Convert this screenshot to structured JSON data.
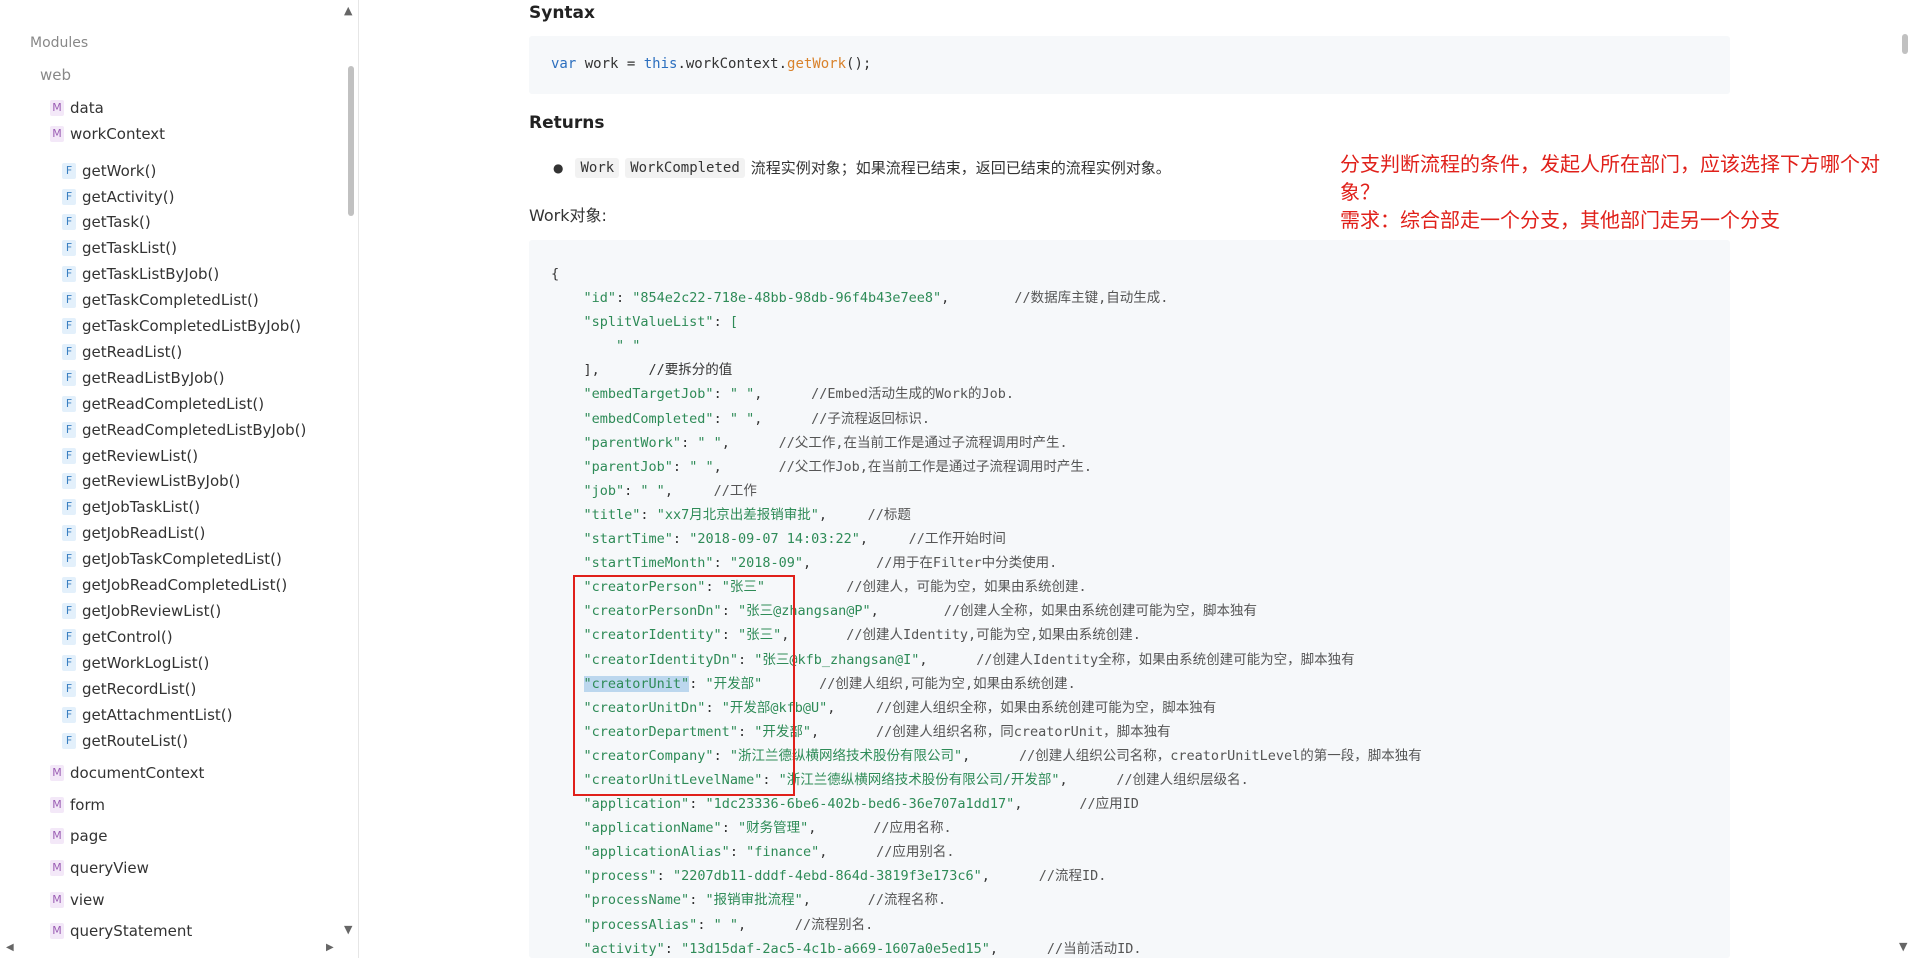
{
  "sidebar": {
    "modules_label": "Modules",
    "web_label": "web",
    "items": [
      {
        "type": "M",
        "label": "data"
      },
      {
        "type": "M",
        "label": "workContext"
      },
      {
        "type": "F",
        "label": "getWork()"
      },
      {
        "type": "F",
        "label": "getActivity()"
      },
      {
        "type": "F",
        "label": "getTask()"
      },
      {
        "type": "F",
        "label": "getTaskList()"
      },
      {
        "type": "F",
        "label": "getTaskListByJob()"
      },
      {
        "type": "F",
        "label": "getTaskCompletedList()"
      },
      {
        "type": "F",
        "label": "getTaskCompletedListByJob()"
      },
      {
        "type": "F",
        "label": "getReadList()"
      },
      {
        "type": "F",
        "label": "getReadListByJob()"
      },
      {
        "type": "F",
        "label": "getReadCompletedList()"
      },
      {
        "type": "F",
        "label": "getReadCompletedListByJob()"
      },
      {
        "type": "F",
        "label": "getReviewList()"
      },
      {
        "type": "F",
        "label": "getReviewListByJob()"
      },
      {
        "type": "F",
        "label": "getJobTaskList()"
      },
      {
        "type": "F",
        "label": "getJobReadList()"
      },
      {
        "type": "F",
        "label": "getJobTaskCompletedList()"
      },
      {
        "type": "F",
        "label": "getJobReadCompletedList()"
      },
      {
        "type": "F",
        "label": "getJobReviewList()"
      },
      {
        "type": "F",
        "label": "getControl()"
      },
      {
        "type": "F",
        "label": "getWorkLogList()"
      },
      {
        "type": "F",
        "label": "getRecordList()"
      },
      {
        "type": "F",
        "label": "getAttachmentList()"
      },
      {
        "type": "F",
        "label": "getRouteList()"
      },
      {
        "type": "M",
        "label": "documentContext"
      },
      {
        "type": "M",
        "label": "form"
      },
      {
        "type": "M",
        "label": "page"
      },
      {
        "type": "M",
        "label": "queryView"
      },
      {
        "type": "M",
        "label": "view"
      },
      {
        "type": "M",
        "label": "queryStatement"
      }
    ]
  },
  "main": {
    "syntax_heading": "Syntax",
    "syntax_code": {
      "kw_var": "var",
      "plain1": " work = ",
      "kw_this": "this",
      "plain2": ".workContext.",
      "fn": "getWork",
      "plain3": "();"
    },
    "returns_heading": "Returns",
    "returns": {
      "chip1": "Work",
      "chip2": "WorkCompleted",
      "desc": "流程实例对象；如果流程已结束，返回已结束的流程实例对象。"
    },
    "work_object_label": "Work对象:",
    "code_lines": [
      {
        "indent": "",
        "key": "",
        "val": "",
        "comment": "",
        "plain": "{"
      },
      {
        "indent": "    ",
        "key": "\"id\"",
        "val": "\"854e2c22-718e-48bb-98db-96f4b43e7ee8\"",
        "sep": ",        ",
        "comment": "//数据库主键,自动生成."
      },
      {
        "indent": "    ",
        "key": "\"splitValueList\"",
        "val": "[",
        "sep": "",
        "comment": ""
      },
      {
        "indent": "        ",
        "key": "",
        "val": "\" \"",
        "sep": "",
        "comment": ""
      },
      {
        "indent": "    ",
        "key": "",
        "val": "",
        "sep": "",
        "comment": "",
        "plain": "],      //要拆分的值"
      },
      {
        "indent": "    ",
        "key": "\"embedTargetJob\"",
        "val": "\" \"",
        "sep": ",      ",
        "comment": "//Embed活动生成的Work的Job."
      },
      {
        "indent": "    ",
        "key": "\"embedCompleted\"",
        "val": "\" \"",
        "sep": ",      ",
        "comment": "//子流程返回标识."
      },
      {
        "indent": "    ",
        "key": "\"parentWork\"",
        "val": "\" \"",
        "sep": ",      ",
        "comment": "//父工作,在当前工作是通过子流程调用时产生."
      },
      {
        "indent": "    ",
        "key": "\"parentJob\"",
        "val": "\" \"",
        "sep": ",       ",
        "comment": "//父工作Job,在当前工作是通过子流程调用时产生."
      },
      {
        "indent": "    ",
        "key": "\"job\"",
        "val": "\" \"",
        "sep": ",     ",
        "comment": "//工作"
      },
      {
        "indent": "    ",
        "key": "\"title\"",
        "val": "\"xx7月北京出差报销审批\"",
        "sep": ",     ",
        "comment": "//标题"
      },
      {
        "indent": "    ",
        "key": "\"startTime\"",
        "val": "\"2018-09-07 14:03:22\"",
        "sep": ",     ",
        "comment": "//工作开始时间"
      },
      {
        "indent": "    ",
        "key": "\"startTimeMonth\"",
        "val": "\"2018-09\"",
        "sep": ",        ",
        "comment": "//用于在Filter中分类使用."
      },
      {
        "indent": "    ",
        "key": "\"creatorPerson\"",
        "val": "\"张三\"",
        "sep": "          ",
        "comment": "//创建人，可能为空，如果由系统创建."
      },
      {
        "indent": "    ",
        "key": "\"creatorPersonDn\"",
        "val": "\"张三@zhangsan@P\"",
        "sep": ",        ",
        "comment": "//创建人全称，如果由系统创建可能为空，脚本独有"
      },
      {
        "indent": "    ",
        "key": "\"creatorIdentity\"",
        "val": "\"张三\"",
        "sep": ",       ",
        "comment": "//创建人Identity,可能为空,如果由系统创建."
      },
      {
        "indent": "    ",
        "key": "\"creatorIdentityDn\"",
        "val": "\"张三@kfb_zhangsan@I\"",
        "sep": ",      ",
        "comment": "//创建人Identity全称，如果由系统创建可能为空，脚本独有"
      },
      {
        "indent": "    ",
        "key": "\"creatorUnit\"",
        "val": "\"开发部\"",
        "sep": "       ",
        "comment": "//创建人组织,可能为空,如果由系统创建.",
        "selected": true
      },
      {
        "indent": "    ",
        "key": "\"creatorUnitDn\"",
        "val": "\"开发部@kfb@U\"",
        "sep": ",     ",
        "comment": "//创建人组织全称，如果由系统创建可能为空，脚本独有"
      },
      {
        "indent": "    ",
        "key": "\"creatorDepartment\"",
        "val": "\"开发部\"",
        "sep": ",       ",
        "comment": "//创建人组织名称，同creatorUnit，脚本独有"
      },
      {
        "indent": "    ",
        "key": "\"creatorCompany\"",
        "val": "\"浙江兰德纵横网络技术股份有限公司\"",
        "sep": ",      ",
        "comment": "//创建人组织公司名称，creatorUnitLevel的第一段，脚本独有"
      },
      {
        "indent": "    ",
        "key": "\"creatorUnitLevelName\"",
        "val": "\"浙江兰德纵横网络技术股份有限公司/开发部\"",
        "sep": ",      ",
        "comment": "//创建人组织层级名."
      },
      {
        "indent": "    ",
        "key": "\"application\"",
        "val": "\"1dc23336-6be6-402b-bed6-36e707a1dd17\"",
        "sep": ",       ",
        "comment": "//应用ID"
      },
      {
        "indent": "    ",
        "key": "\"applicationName\"",
        "val": "\"财务管理\"",
        "sep": ",       ",
        "comment": "//应用名称."
      },
      {
        "indent": "    ",
        "key": "\"applicationAlias\"",
        "val": "\"finance\"",
        "sep": ",      ",
        "comment": "//应用别名."
      },
      {
        "indent": "    ",
        "key": "\"process\"",
        "val": "\"2207db11-dddf-4ebd-864d-3819f3e173c6\"",
        "sep": ",      ",
        "comment": "//流程ID."
      },
      {
        "indent": "    ",
        "key": "\"processName\"",
        "val": "\"报销审批流程\"",
        "sep": ",       ",
        "comment": "//流程名称."
      },
      {
        "indent": "    ",
        "key": "\"processAlias\"",
        "val": "\" \"",
        "sep": ",      ",
        "comment": "//流程别名."
      },
      {
        "indent": "    ",
        "key": "\"activity\"",
        "val": "\"13d15daf-2ac5-4c1b-a669-1607a0e5ed15\"",
        "sep": ",      ",
        "comment": "//当前活动ID."
      }
    ],
    "annotation_lines": [
      "分支判断流程的条件，发起人所在部门，应该选择下方哪个对象？",
      "需求：综合部走一个分支，其他部门走另一个分支"
    ]
  },
  "colors": {
    "annotation": "#e0201a",
    "code_key": "#2e8b57",
    "keyword": "#2c6fbf",
    "function": "#d9822b",
    "code_bg": "#f6f8fa"
  }
}
